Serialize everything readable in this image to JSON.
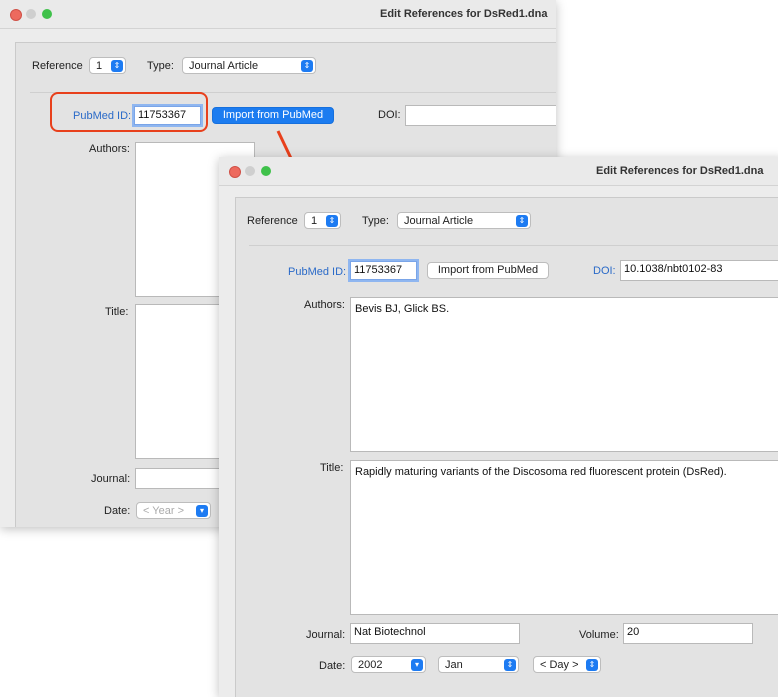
{
  "back": {
    "title": "Edit References for DsRed1.dna",
    "reference_label": "Reference",
    "reference_value": "1",
    "type_label": "Type:",
    "type_value": "Journal Article",
    "pubmed_label": "PubMed ID:",
    "pubmed_value": "11753367",
    "import_button": "Import from PubMed",
    "doi_label": "DOI:",
    "doi_value": "",
    "authors_label": "Authors:",
    "title_label": "Title:",
    "journal_label": "Journal:",
    "date_label": "Date:",
    "year_placeholder": "< Year >"
  },
  "front": {
    "title": "Edit References for DsRed1.dna",
    "reference_label": "Reference",
    "reference_value": "1",
    "type_label": "Type:",
    "type_value": "Journal Article",
    "pubmed_label": "PubMed ID:",
    "pubmed_value": "11753367",
    "import_button": "Import from PubMed",
    "doi_label": "DOI:",
    "doi_value": "10.1038/nbt0102-83",
    "authors_label": "Authors:",
    "authors_value": "Bevis BJ, Glick BS.",
    "title_label": "Title:",
    "title_value": "Rapidly maturing variants of the Discosoma red fluorescent protein (DsRed).",
    "journal_label": "Journal:",
    "journal_value": "Nat Biotechnol",
    "volume_label": "Volume:",
    "volume_value": "20",
    "date_label": "Date:",
    "year_value": "2002",
    "month_value": "Jan",
    "day_value": "< Day >"
  },
  "colors": {
    "accent": "#1c7cf0",
    "highlight": "#e8401c",
    "link_label": "#2a6ac8"
  }
}
